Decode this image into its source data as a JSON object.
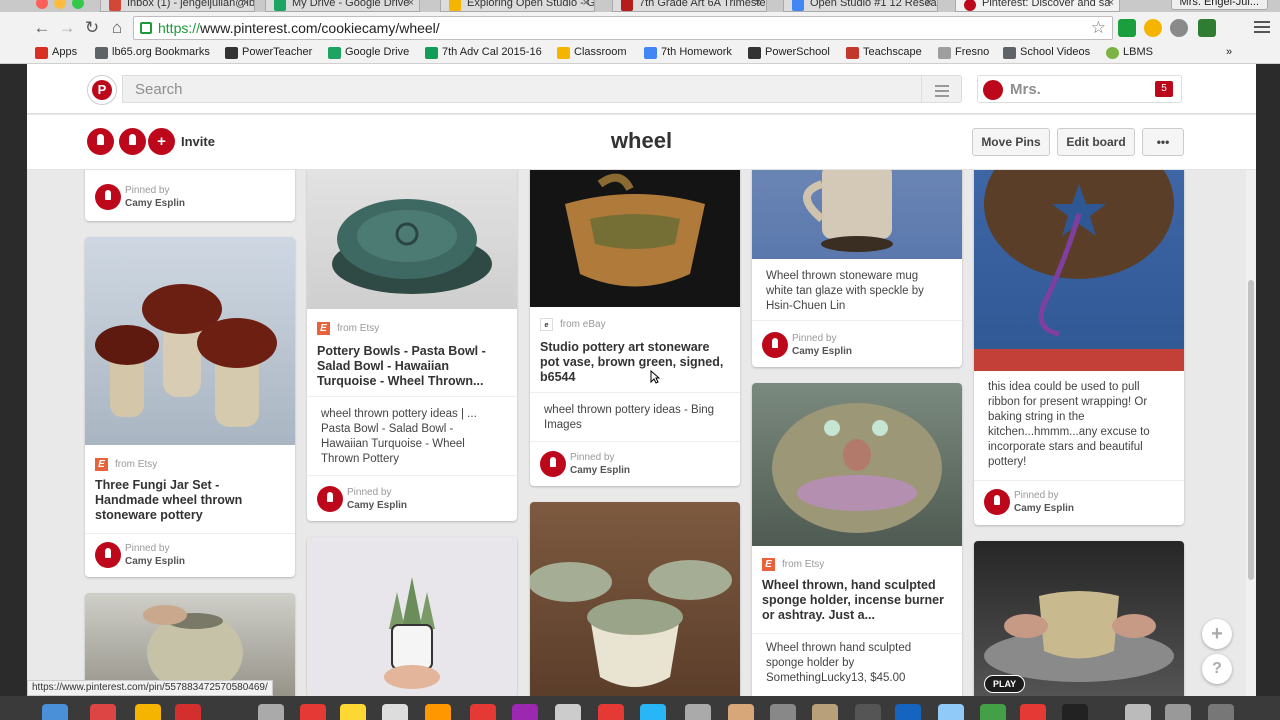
{
  "browser": {
    "tabs": [
      {
        "label": "Inbox (1) - jengeljulian@lb",
        "color": "#d14836"
      },
      {
        "label": "My Drive - Google Drive",
        "color": "#1da462"
      },
      {
        "label": "Exploring Open Studio - G",
        "color": "#f4b400"
      },
      {
        "label": "7th Grade Art 6A Trimeste",
        "color": "#b71c1c"
      },
      {
        "label": "Open Studio #1 12 Resear",
        "color": "#4285f4"
      },
      {
        "label": "Pinterest: Discover and sa",
        "color": "#bd081c"
      }
    ],
    "user_chip": "Mrs. Engel-Jul...",
    "url_scheme": "https://",
    "url_rest": "www.pinterest.com/cookiecamy/wheel/",
    "bookmarks": [
      {
        "label": "Apps",
        "color": "#d93025"
      },
      {
        "label": "lb65.org Bookmarks",
        "color": "#5f6368"
      },
      {
        "label": "PowerTeacher",
        "color": "#333333"
      },
      {
        "label": "Google Drive",
        "color": "#1da462"
      },
      {
        "label": "7th Adv Cal 2015-16",
        "color": "#0f9d58"
      },
      {
        "label": "Classroom",
        "color": "#f4b400"
      },
      {
        "label": "7th Homework",
        "color": "#4285f4"
      },
      {
        "label": "PowerSchool",
        "color": "#333333"
      },
      {
        "label": "Teachscape",
        "color": "#c0392b"
      },
      {
        "label": "Fresno",
        "color": "#9e9e9e"
      },
      {
        "label": "School Videos",
        "color": "#5f6368"
      },
      {
        "label": "LBMS",
        "color": "#7cb342"
      }
    ],
    "status_url": "https://www.pinterest.com/pin/557883472570580469/"
  },
  "pinterest": {
    "search_placeholder": "Search",
    "user_name": "Mrs.",
    "notification_count": "5",
    "board_title": "wheel",
    "invite_label": "Invite",
    "move_pins_label": "Move Pins",
    "edit_board_label": "Edit board",
    "more_label": "•••",
    "brand_color": "#bd081c"
  },
  "pins": [
    {
      "id": "c1a",
      "pinned_by": "Pinned by",
      "pinner": "Camy Esplin"
    },
    {
      "id": "c1b",
      "source": "from Etsy",
      "title": "Three Fungi Jar Set - Handmade wheel thrown stoneware pottery",
      "pinned_by": "Pinned by",
      "pinner": "Camy Esplin"
    },
    {
      "id": "c2a",
      "source": "from Etsy",
      "title": "Pottery Bowls - Pasta Bowl - Salad Bowl - Hawaiian Turquoise - Wheel Thrown...",
      "desc": "wheel thrown pottery ideas | ... Pasta Bowl - Salad Bowl - Hawaiian Turquoise - Wheel Thrown Pottery",
      "pinned_by": "Pinned by",
      "pinner": "Camy Esplin"
    },
    {
      "id": "c3a",
      "source": "from eBay",
      "title": "Studio pottery art stoneware pot vase, brown green, signed, b6544",
      "desc": "wheel thrown pottery ideas - Bing Images",
      "pinned_by": "Pinned by",
      "pinner": "Camy Esplin"
    },
    {
      "id": "c4a",
      "desc": "Wheel thrown stoneware mug white tan glaze with speckle by Hsin-Chuen Lin",
      "pinned_by": "Pinned by",
      "pinner": "Camy Esplin"
    },
    {
      "id": "c4b",
      "source": "from Etsy",
      "title": "Wheel thrown, hand sculpted sponge holder, incense burner or ashtray. Just a...",
      "desc": "Wheel thrown hand sculpted sponge holder by SomethingLucky13, $45.00"
    },
    {
      "id": "c5a",
      "desc": "this idea could be used to pull ribbon for present wrapping! Or baking string in the kitchen...hmmm...any excuse to incorporate stars and beautiful pottery!",
      "pinned_by": "Pinned by",
      "pinner": "Camy Esplin"
    },
    {
      "id": "c5b",
      "badge": "PLAY"
    }
  ]
}
